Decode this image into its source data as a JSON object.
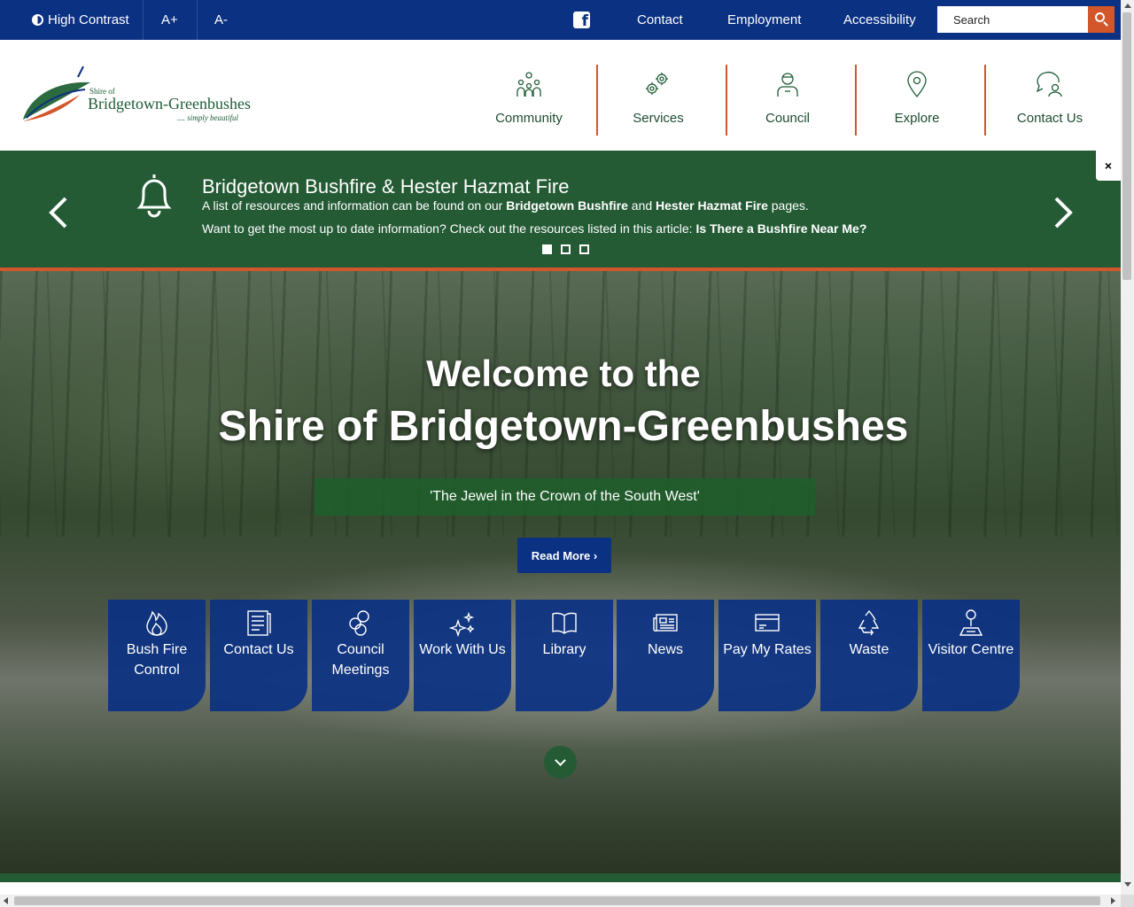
{
  "topbar": {
    "high_contrast": "High Contrast",
    "font_increase": "A+",
    "font_decrease": "A-",
    "links": [
      "Contact",
      "Employment",
      "Accessibility"
    ],
    "search_placeholder": "Search",
    "facebook_icon": "facebook-icon",
    "search_icon": "search-icon"
  },
  "logo": {
    "small": "Shire of",
    "name": "Bridgetown-Greenbushes",
    "tagline": ".... simply beautiful"
  },
  "nav": [
    {
      "label": "Community",
      "icon": "community-icon"
    },
    {
      "label": "Services",
      "icon": "gears-icon"
    },
    {
      "label": "Council",
      "icon": "person-icon"
    },
    {
      "label": "Explore",
      "icon": "map-pin-icon"
    },
    {
      "label": "Contact Us",
      "icon": "chat-person-icon"
    }
  ],
  "alert": {
    "icon": "bell-icon",
    "title": "Bridgetown Bushfire & Hester Hazmat Fire",
    "line1_pre": "A list of resources and information can be found on our",
    "line1_link1": "Bridgetown Bushfire",
    "line1_mid": "and",
    "line1_link2": "Hester Hazmat Fire",
    "line1_post": "pages.",
    "line2_pre": "Want to get the most up to date information? Check out the resources listed in this article:",
    "line2_link": "Is There a Bushfire Near Me?",
    "slide_count": 3,
    "active_slide": 1,
    "close": "×"
  },
  "hero": {
    "title_line1": "Welcome to the",
    "title_line2": "Shire of Bridgetown-Greenbushes",
    "tagline": "'The Jewel in the Crown of the South West'",
    "read_more": "Read More ›"
  },
  "tiles": [
    {
      "label": "Bush Fire Control",
      "icon": "fire-icon"
    },
    {
      "label": "Contact Us",
      "icon": "document-icon"
    },
    {
      "label": "Council Meetings",
      "icon": "people-circles-icon"
    },
    {
      "label": "Work With Us",
      "icon": "sparkles-icon"
    },
    {
      "label": "Library",
      "icon": "book-icon"
    },
    {
      "label": "News",
      "icon": "newspaper-icon"
    },
    {
      "label": "Pay My Rates",
      "icon": "credit-card-icon"
    },
    {
      "label": "Waste",
      "icon": "recycle-icon"
    },
    {
      "label": "Visitor Centre",
      "icon": "map-pin-person-icon"
    }
  ],
  "colors": {
    "navy": "#0b3182",
    "green": "#245b35",
    "orange": "#d2562a"
  }
}
